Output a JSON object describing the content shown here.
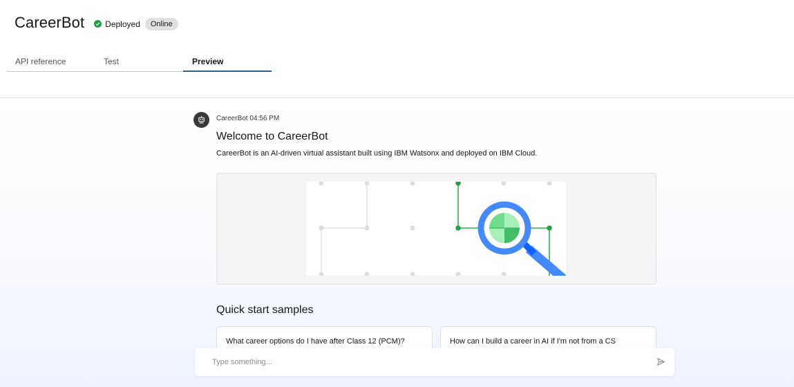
{
  "header": {
    "title": "CareerBot",
    "status_label": "Deployed",
    "badge": "Online",
    "tabs": [
      {
        "label": "API reference",
        "active": false
      },
      {
        "label": "Test",
        "active": false
      },
      {
        "label": "Preview",
        "active": true
      }
    ]
  },
  "chat": {
    "bot_name": "CareerBot",
    "time": "04:56 PM",
    "welcome": "Welcome to CareerBot",
    "description": "CareerBot is an AI-driven virtual assistant built using IBM Watsonx and deployed on IBM Cloud.",
    "quick_start_title": "Quick start samples",
    "samples": [
      "What career options do I have after Class 12 (PCM)?",
      "How can I build a career in AI if I'm not from a CS background?"
    ],
    "input_placeholder": "Type something..."
  },
  "colors": {
    "accent": "#0f62fe",
    "status_green": "#24a148",
    "illustration_green": "#42be65",
    "illustration_blue": "#4589ff"
  }
}
